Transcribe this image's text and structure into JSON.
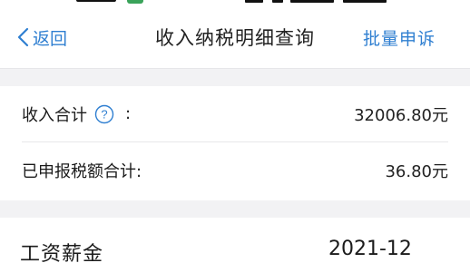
{
  "nav": {
    "back_label": "返回",
    "title": "收入纳税明细查询",
    "action_label": "批量申诉"
  },
  "summary": {
    "income_total_label": "收入合计",
    "income_total_suffix": ":",
    "income_total_value": "32006.80元",
    "tax_total_label": "已申报税额合计:",
    "tax_total_value": "36.80元"
  },
  "records": [
    {
      "type": "工资薪金",
      "period": "2021-12"
    }
  ],
  "colors": {
    "accent": "#2f7fd1",
    "background": "#f2f2f4"
  }
}
